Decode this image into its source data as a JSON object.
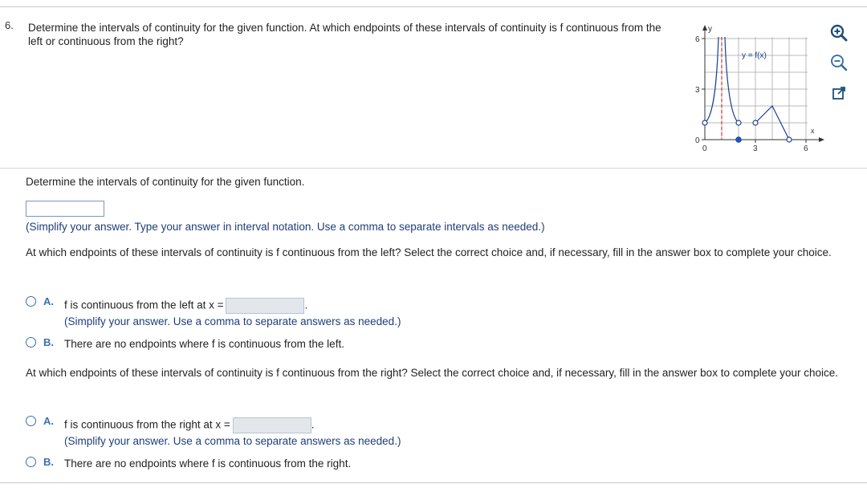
{
  "question": {
    "number": "6.",
    "prompt": "Determine the intervals of continuity for the given function. At which endpoints of these intervals of continuity is f continuous from the left or continuous from the right?"
  },
  "graph": {
    "y_axis_label": "y",
    "x_axis_label": "x",
    "function_label": "y = f(x)",
    "y_ticks": [
      "6",
      "3",
      "0"
    ],
    "x_ticks": [
      "0",
      "3",
      "6"
    ],
    "x_range": [
      0,
      6.6
    ],
    "y_range": [
      0,
      6.6
    ],
    "open_points": [
      [
        0,
        1
      ],
      [
        2,
        1
      ],
      [
        3,
        1
      ],
      [
        5,
        0
      ]
    ],
    "closed_points": [
      [
        2,
        0
      ]
    ],
    "asymptote_x": 1,
    "curve_color": "#1a3f8f",
    "asymptote_color": "#e03030"
  },
  "tools": [
    "zoom-in-icon",
    "zoom-out-icon",
    "external-link-icon"
  ],
  "part1": {
    "prompt": "Determine the intervals of continuity for the given function.",
    "hint": "(Simplify your answer. Type your answer in interval notation. Use a comma to separate intervals as needed.)"
  },
  "part2": {
    "prompt": "At which endpoints of these intervals of continuity is f continuous from the left? Select the correct choice and, if necessary, fill in the answer box to complete your choice.",
    "choice_a_letter": "A.",
    "choice_a_text": "f is continuous from the left at x =",
    "choice_a_hint": "(Simplify your answer. Use a comma to separate answers as needed.)",
    "choice_b_letter": "B.",
    "choice_b_text": "There are no endpoints where f is continuous from the left."
  },
  "part3": {
    "prompt": "At which endpoints of these intervals of continuity is f continuous from the right? Select the correct choice and, if necessary, fill in the answer box to complete your choice.",
    "choice_a_letter": "A.",
    "choice_a_text": "f is continuous from the right at x =",
    "choice_a_hint": "(Simplify your answer. Use a comma to separate answers as needed.)",
    "choice_b_letter": "B.",
    "choice_b_text": "There are no endpoints where f is continuous from the right."
  }
}
